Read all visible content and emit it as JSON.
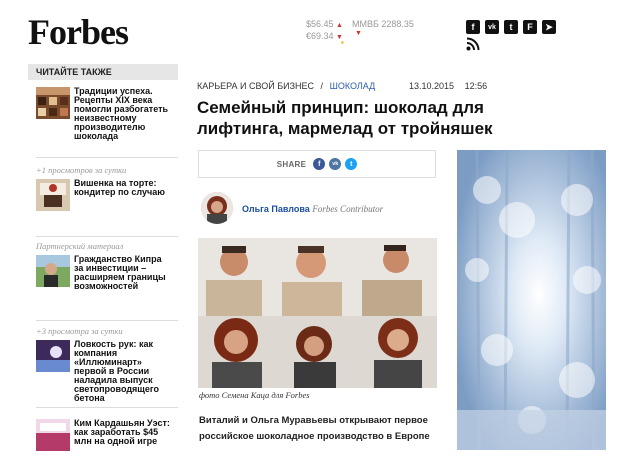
{
  "header": {
    "logo": "Forbes",
    "ticker": {
      "usd": "$56.45",
      "eur": "€69.34",
      "index": "ММВБ 2288.35"
    },
    "social_icons": [
      "facebook-icon",
      "vk-icon",
      "twitter-icon",
      "flipboard-icon",
      "telegram-icon",
      "rss-icon"
    ]
  },
  "sidebar": {
    "heading": "ЧИТАЙТЕ ТАКЖЕ",
    "items": [
      {
        "meta": "",
        "title": "Традиции успеха. Рецепты XIX века помогли разбогатеть неизвестному производителю шоколада"
      },
      {
        "meta": "+1 просмотров за сутки",
        "title": "Вишенка на торте: кондитер по случаю"
      },
      {
        "meta": "Партнерский материал",
        "title": "Гражданство Кипра за инвестиции – расширяем границы возможностей"
      },
      {
        "meta": "+3 просмотра за сутки",
        "title": "Ловкость рук: как компания «Иллюминарт» первой в России наладила выпуск светопроводящего бетона"
      },
      {
        "meta": "",
        "title": "Ким Кардашьян Уэст: как заработать $45 млн на одной игре"
      }
    ]
  },
  "article": {
    "breadcrumb": {
      "section": "КАРЬЕРА И СВОЙ БИЗНЕС",
      "separator": "/",
      "tag": "ШОКОЛАД"
    },
    "date": "13.10.2015",
    "time": "12:56",
    "title": "Семейный принцип: шоколад для лифтинга, мармелад от тройняшек",
    "share": {
      "label": "SHARE",
      "buttons": [
        "f",
        "vk",
        "t"
      ]
    },
    "author": {
      "name": "Ольга Павлова",
      "role": "Forbes Contributor"
    },
    "photo_caption": "фото Семена Каца для Forbes",
    "lead": "Виталий и Ольга Муравьевы открывают первое российское шоколадное производство в Европе"
  },
  "colors": {
    "link": "#2a5db0",
    "facebook": "#3b5998",
    "vk": "#4c75a3",
    "twitter": "#1da1f2",
    "sidebar_heading_bg": "#e6e6e6"
  }
}
